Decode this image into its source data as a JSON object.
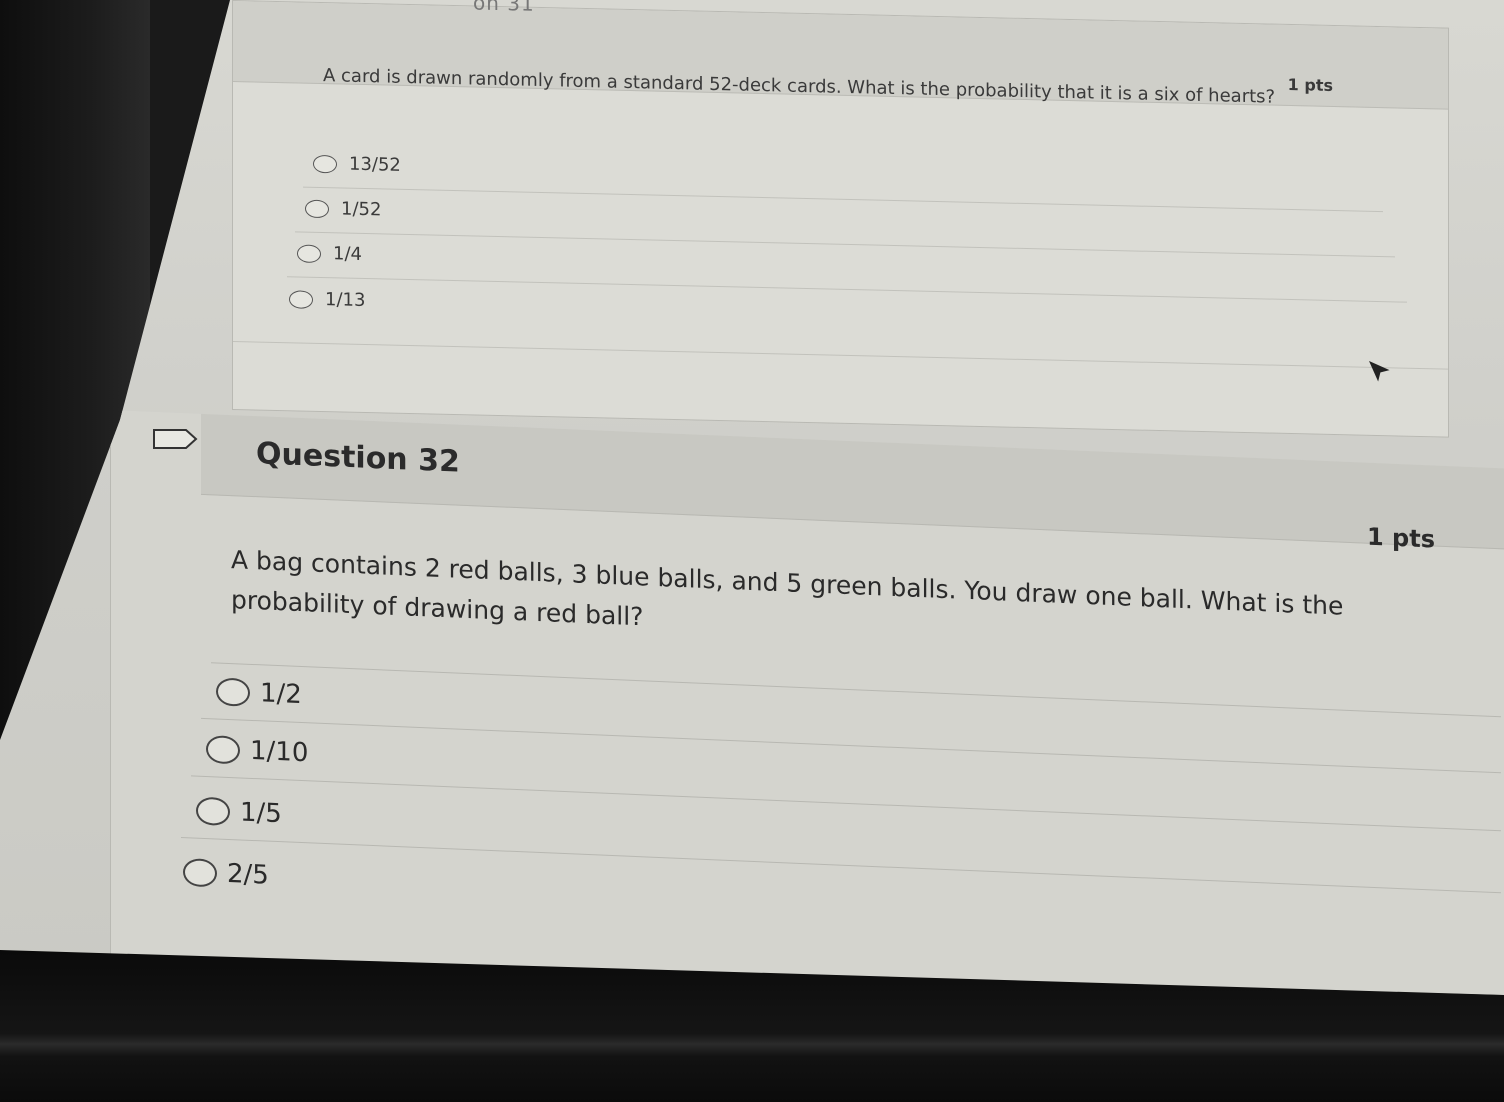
{
  "question31": {
    "title_fragment": "on 31",
    "points": "1 pts",
    "text": "A card is drawn randomly from a standard 52-deck cards. What is the probability that it is a six of hearts?",
    "options": [
      "13/52",
      "1/52",
      "1/4",
      "1/13"
    ]
  },
  "question32": {
    "title": "Question 32",
    "points": "1 pts",
    "text": "A bag contains 2 red balls, 3 blue balls, and 5 green balls. You draw one ball. What is the probability of drawing a red ball?",
    "options": [
      "1/2",
      "1/10",
      "1/5",
      "2/5"
    ]
  },
  "icons": {
    "bookmark": "bookmark-flag-icon",
    "cursor": "mouse-pointer-icon"
  },
  "colors": {
    "background": "#d8d8d2",
    "header": "#c8c8c2",
    "text": "#2a2a2a"
  }
}
